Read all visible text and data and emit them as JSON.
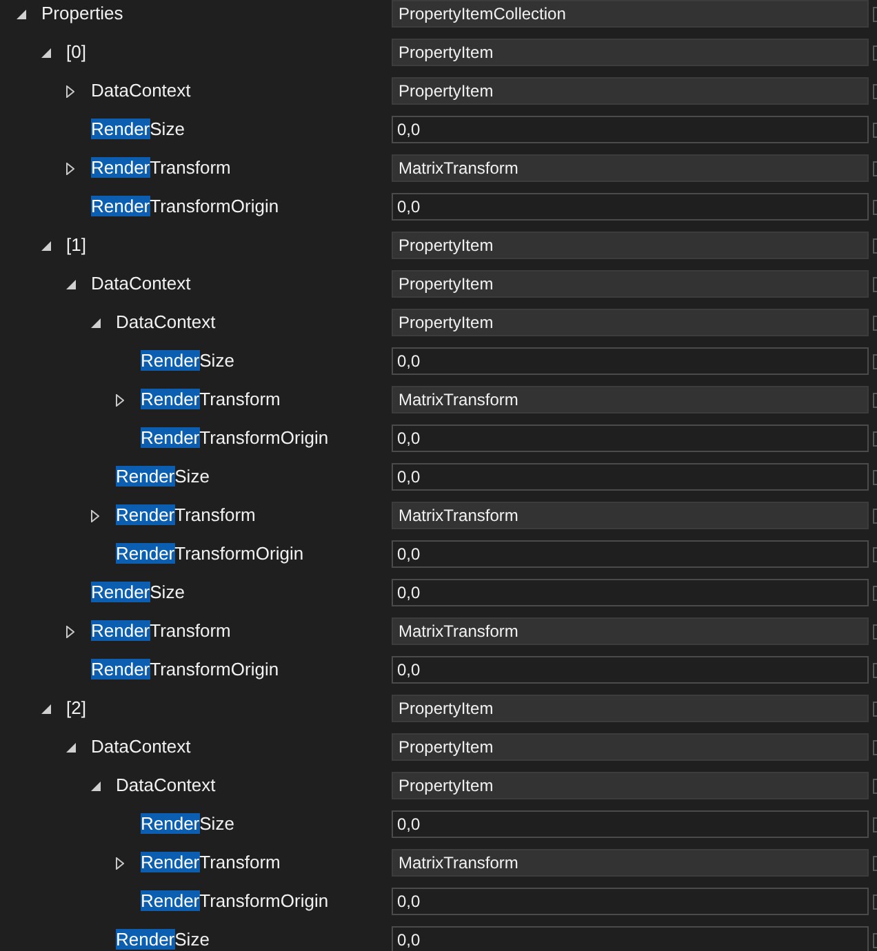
{
  "tree": [
    {
      "name": [
        {
          "text": "Properties",
          "highlighted": false
        }
      ],
      "value": "PropertyItemCollection",
      "editable": false,
      "expanded": true,
      "children": [
        {
          "name": [
            {
              "text": "[0]",
              "highlighted": false
            }
          ],
          "value": "PropertyItem",
          "editable": false,
          "expanded": true,
          "children": [
            {
              "name": [
                {
                  "text": "DataContext",
                  "highlighted": false
                }
              ],
              "value": "PropertyItem",
              "editable": false,
              "expanded": false
            },
            {
              "name": [
                {
                  "text": "Render",
                  "highlighted": true
                },
                {
                  "text": "Size",
                  "highlighted": false
                }
              ],
              "value": "0,0",
              "editable": true
            },
            {
              "name": [
                {
                  "text": "Render",
                  "highlighted": true
                },
                {
                  "text": "Transform",
                  "highlighted": false
                }
              ],
              "value": "MatrixTransform",
              "editable": false,
              "expanded": false
            },
            {
              "name": [
                {
                  "text": "Render",
                  "highlighted": true
                },
                {
                  "text": "TransformOrigin",
                  "highlighted": false
                }
              ],
              "value": "0,0",
              "editable": true
            }
          ]
        },
        {
          "name": [
            {
              "text": "[1]",
              "highlighted": false
            }
          ],
          "value": "PropertyItem",
          "editable": false,
          "expanded": true,
          "children": [
            {
              "name": [
                {
                  "text": "DataContext",
                  "highlighted": false
                }
              ],
              "value": "PropertyItem",
              "editable": false,
              "expanded": true,
              "children": [
                {
                  "name": [
                    {
                      "text": "DataContext",
                      "highlighted": false
                    }
                  ],
                  "value": "PropertyItem",
                  "editable": false,
                  "expanded": true,
                  "children": [
                    {
                      "name": [
                        {
                          "text": "Render",
                          "highlighted": true
                        },
                        {
                          "text": "Size",
                          "highlighted": false
                        }
                      ],
                      "value": "0,0",
                      "editable": true
                    },
                    {
                      "name": [
                        {
                          "text": "Render",
                          "highlighted": true
                        },
                        {
                          "text": "Transform",
                          "highlighted": false
                        }
                      ],
                      "value": "MatrixTransform",
                      "editable": false,
                      "expanded": false
                    },
                    {
                      "name": [
                        {
                          "text": "Render",
                          "highlighted": true
                        },
                        {
                          "text": "TransformOrigin",
                          "highlighted": false
                        }
                      ],
                      "value": "0,0",
                      "editable": true
                    }
                  ]
                },
                {
                  "name": [
                    {
                      "text": "Render",
                      "highlighted": true
                    },
                    {
                      "text": "Size",
                      "highlighted": false
                    }
                  ],
                  "value": "0,0",
                  "editable": true
                },
                {
                  "name": [
                    {
                      "text": "Render",
                      "highlighted": true
                    },
                    {
                      "text": "Transform",
                      "highlighted": false
                    }
                  ],
                  "value": "MatrixTransform",
                  "editable": false,
                  "expanded": false
                },
                {
                  "name": [
                    {
                      "text": "Render",
                      "highlighted": true
                    },
                    {
                      "text": "TransformOrigin",
                      "highlighted": false
                    }
                  ],
                  "value": "0,0",
                  "editable": true
                }
              ]
            },
            {
              "name": [
                {
                  "text": "Render",
                  "highlighted": true
                },
                {
                  "text": "Size",
                  "highlighted": false
                }
              ],
              "value": "0,0",
              "editable": true
            },
            {
              "name": [
                {
                  "text": "Render",
                  "highlighted": true
                },
                {
                  "text": "Transform",
                  "highlighted": false
                }
              ],
              "value": "MatrixTransform",
              "editable": false,
              "expanded": false
            },
            {
              "name": [
                {
                  "text": "Render",
                  "highlighted": true
                },
                {
                  "text": "TransformOrigin",
                  "highlighted": false
                }
              ],
              "value": "0,0",
              "editable": true
            }
          ]
        },
        {
          "name": [
            {
              "text": "[2]",
              "highlighted": false
            }
          ],
          "value": "PropertyItem",
          "editable": false,
          "expanded": true,
          "children": [
            {
              "name": [
                {
                  "text": "DataContext",
                  "highlighted": false
                }
              ],
              "value": "PropertyItem",
              "editable": false,
              "expanded": true,
              "children": [
                {
                  "name": [
                    {
                      "text": "DataContext",
                      "highlighted": false
                    }
                  ],
                  "value": "PropertyItem",
                  "editable": false,
                  "expanded": true,
                  "children": [
                    {
                      "name": [
                        {
                          "text": "Render",
                          "highlighted": true
                        },
                        {
                          "text": "Size",
                          "highlighted": false
                        }
                      ],
                      "value": "0,0",
                      "editable": true
                    },
                    {
                      "name": [
                        {
                          "text": "Render",
                          "highlighted": true
                        },
                        {
                          "text": "Transform",
                          "highlighted": false
                        }
                      ],
                      "value": "MatrixTransform",
                      "editable": false,
                      "expanded": false
                    },
                    {
                      "name": [
                        {
                          "text": "Render",
                          "highlighted": true
                        },
                        {
                          "text": "TransformOrigin",
                          "highlighted": false
                        }
                      ],
                      "value": "0,0",
                      "editable": true
                    }
                  ]
                },
                {
                  "name": [
                    {
                      "text": "Render",
                      "highlighted": true
                    },
                    {
                      "text": "Size",
                      "highlighted": false
                    }
                  ],
                  "value": "0,0",
                  "editable": true
                }
              ]
            }
          ]
        }
      ]
    }
  ]
}
